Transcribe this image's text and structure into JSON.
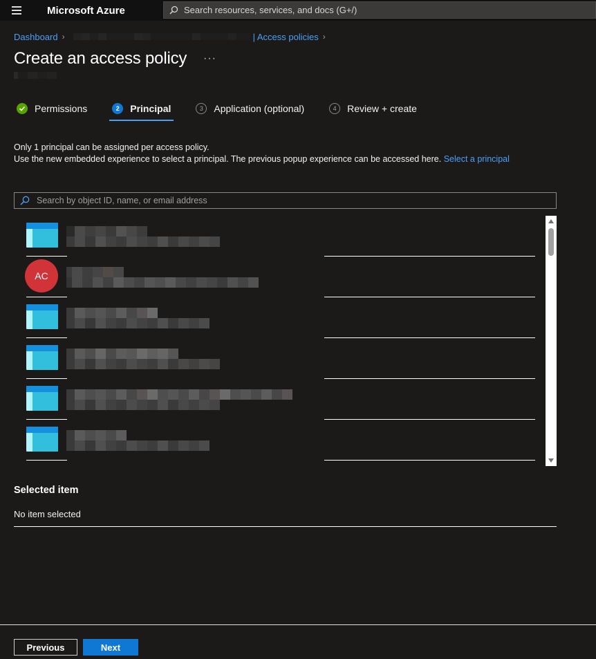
{
  "topbar": {
    "brand": "Microsoft Azure",
    "search_placeholder": "Search resources, services, and docs (G+/)"
  },
  "breadcrumb": {
    "first": "Dashboard",
    "last": "| Access policies"
  },
  "page": {
    "title": "Create an access policy",
    "more": "···"
  },
  "tabs": [
    {
      "badge": "",
      "label": "Permissions",
      "state": "done"
    },
    {
      "badge": "2",
      "label": "Principal",
      "state": "active"
    },
    {
      "badge": "3",
      "label": "Application (optional)",
      "state": "pending"
    },
    {
      "badge": "4",
      "label": "Review + create",
      "state": "pending"
    }
  ],
  "info": {
    "line1": "Only 1 principal can be assigned per access policy.",
    "line2": "Use the new embedded experience to select a principal. The previous popup experience can be accessed here.",
    "link": "Select a principal"
  },
  "principal_search": {
    "placeholder": "Search by object ID, name, or email address"
  },
  "principals": [
    {
      "type": "app",
      "initials": ""
    },
    {
      "type": "user",
      "initials": "AC"
    },
    {
      "type": "app",
      "initials": ""
    },
    {
      "type": "app",
      "initials": ""
    },
    {
      "type": "app",
      "initials": ""
    },
    {
      "type": "app",
      "initials": ""
    }
  ],
  "selected": {
    "title": "Selected item",
    "value": "No item selected"
  },
  "footer": {
    "previous": "Previous",
    "next": "Next"
  },
  "colors": {
    "accent": "#0f78d4",
    "link": "#4aa0f5",
    "done": "#57a300",
    "avatar": "#d13438",
    "background": "#1b1a19"
  }
}
